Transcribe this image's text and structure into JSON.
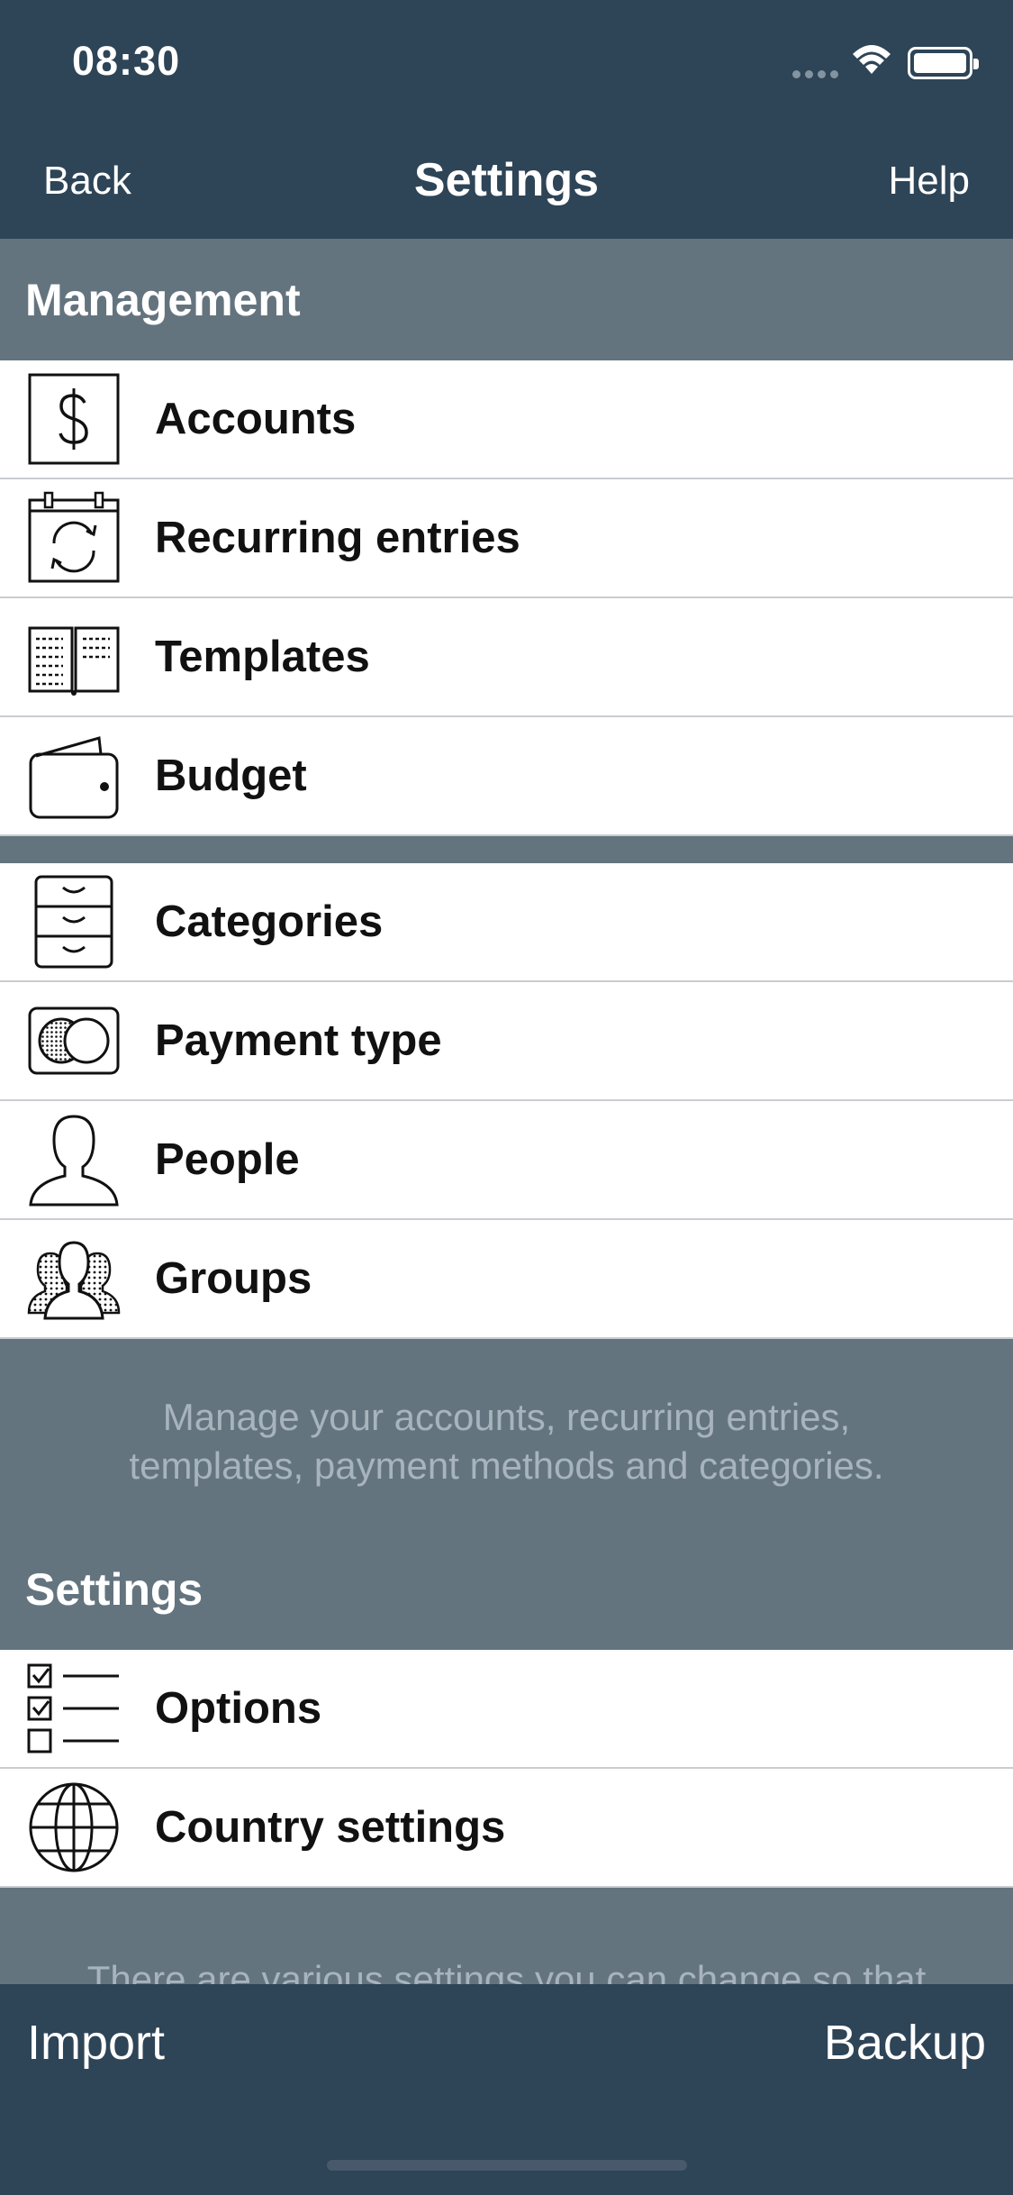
{
  "status_bar": {
    "time": "08:30"
  },
  "nav": {
    "back": "Back",
    "title": "Settings",
    "help": "Help"
  },
  "management": {
    "header": "Management",
    "group1": [
      {
        "label": "Accounts",
        "icon": "dollar-icon"
      },
      {
        "label": "Recurring entries",
        "icon": "recurring-calendar-icon"
      },
      {
        "label": "Templates",
        "icon": "book-icon"
      },
      {
        "label": "Budget",
        "icon": "wallet-icon"
      }
    ],
    "group2": [
      {
        "label": "Categories",
        "icon": "filing-cabinet-icon"
      },
      {
        "label": "Payment type",
        "icon": "payment-card-icon"
      },
      {
        "label": "People",
        "icon": "person-icon"
      },
      {
        "label": "Groups",
        "icon": "group-icon"
      }
    ],
    "footer": "Manage your accounts, recurring entries, templates, payment methods and categories."
  },
  "settings": {
    "header": "Settings",
    "items": [
      {
        "label": "Options",
        "icon": "checklist-icon"
      },
      {
        "label": "Country settings",
        "icon": "globe-icon"
      }
    ],
    "footer": "There are various settings you can change so that"
  },
  "toolbar": {
    "import": "Import",
    "backup": "Backup"
  }
}
